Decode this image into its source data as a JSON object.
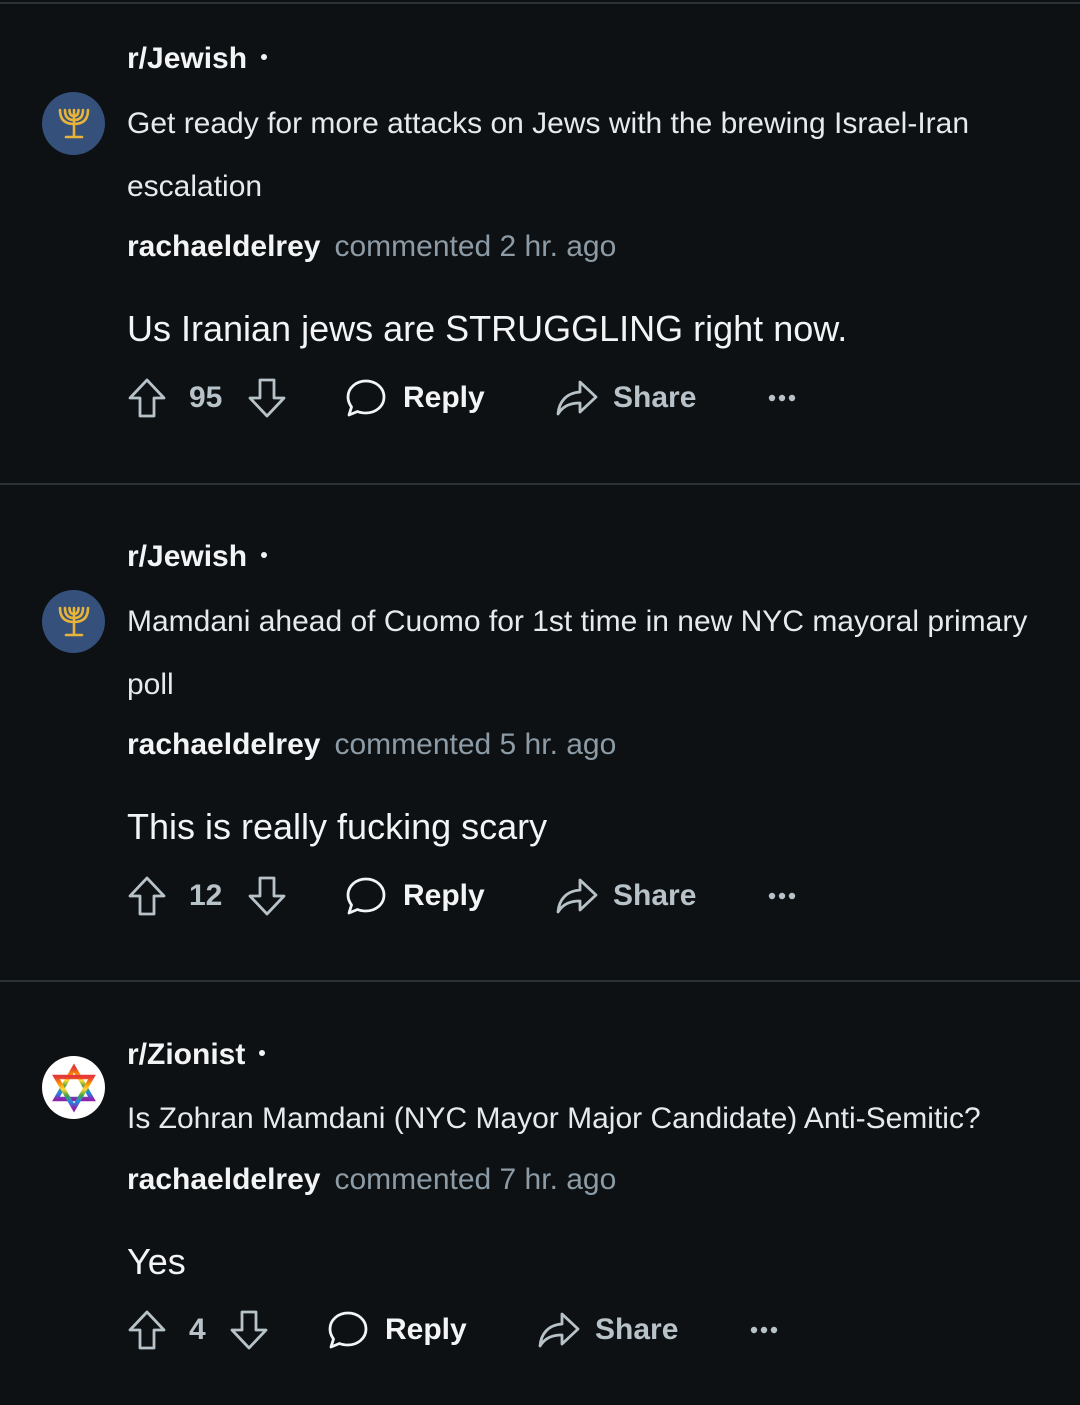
{
  "comments": [
    {
      "subreddit": "r/Jewish",
      "avatar_icon": "menorah-icon",
      "post_title": "Get ready for more attacks on Jews with the brewing Israel-Iran escalation",
      "username": "rachaeldelrey",
      "timestamp": "commented 2 hr. ago",
      "body": "Us Iranian jews are STRUGGLING right now.",
      "score": "95",
      "reply_label": "Reply",
      "share_label": "Share"
    },
    {
      "subreddit": "r/Jewish",
      "avatar_icon": "menorah-icon",
      "post_title": "Mamdani ahead of Cuomo for 1st time in new NYC mayoral primary poll",
      "username": "rachaeldelrey",
      "timestamp": "commented 5 hr. ago",
      "body": "This is really fucking scary",
      "score": "12",
      "reply_label": "Reply",
      "share_label": "Share"
    },
    {
      "subreddit": "r/Zionist",
      "avatar_icon": "rainbow-star-of-david-icon",
      "post_title": "Is Zohran Mamdani (NYC Mayor Major Candidate) Anti-Semitic?",
      "username": "rachaeldelrey",
      "timestamp": "commented 7 hr. ago",
      "body": "Yes",
      "score": "4",
      "reply_label": "Reply",
      "share_label": "Share"
    }
  ],
  "colors": {
    "background": "#0e1113",
    "divider": "#2a3236",
    "avatar_blue": "#34507b",
    "menorah_gold": "#e8b339",
    "muted_text": "#8c9ba5"
  }
}
